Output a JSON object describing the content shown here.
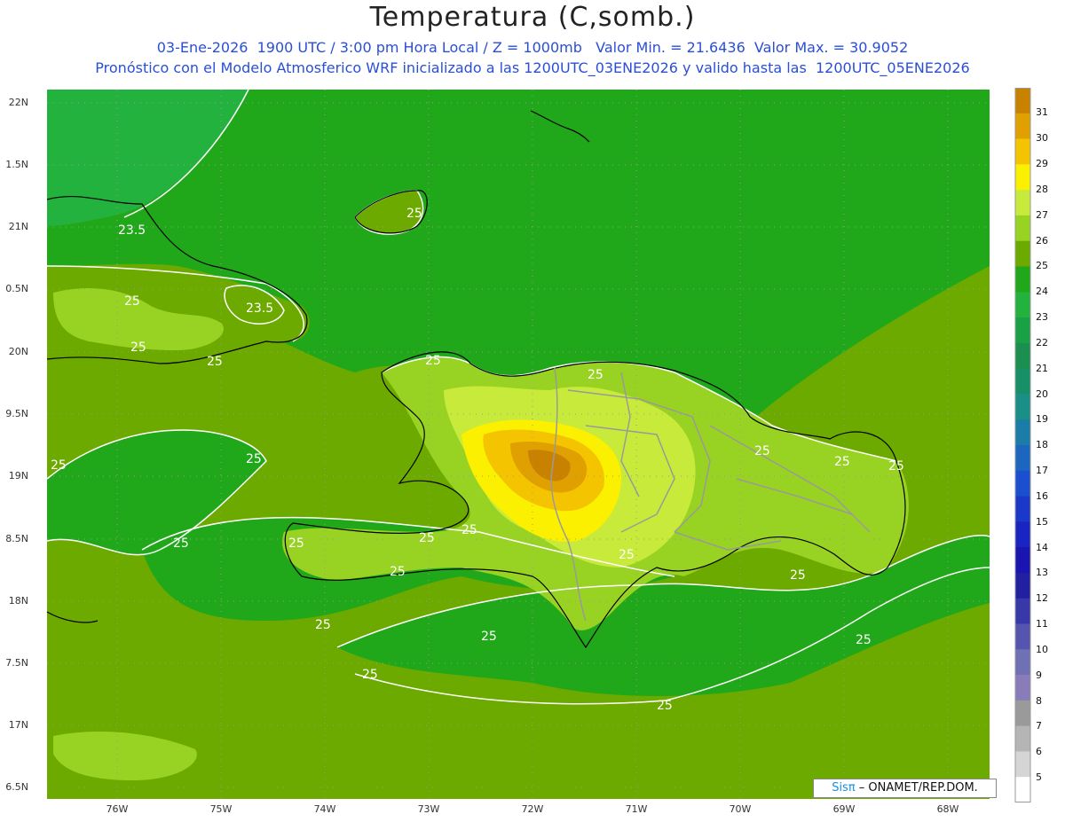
{
  "header": {
    "title": "Temperatura (C,somb.)",
    "line1": "03-Ene-2026  1900 UTC / 3:00 pm Hora Local / Z = 1000mb   Valor Min. = 21.6436  Valor Max. = 30.9052",
    "line2": "Pronóstico con el Modelo Atmosferico WRF inicializado a las 1200UTC_03ENE2026 y valido hasta las  1200UTC_05ENE2026"
  },
  "map": {
    "lat_labels": [
      "22N",
      "1.5N",
      "21N",
      "0.5N",
      "20N",
      "9.5N",
      "19N",
      "8.5N",
      "18N",
      "7.5N",
      "17N",
      "6.5N"
    ],
    "lon_labels": [
      "76W",
      "75W",
      "74W",
      "73W",
      "72W",
      "71W",
      "70W",
      "69W",
      "68W"
    ],
    "contour_labels": [
      "23.5",
      "23.5",
      "25",
      "25",
      "25",
      "25",
      "25",
      "25",
      "25",
      "25",
      "25",
      "25",
      "25",
      "25",
      "25",
      "25",
      "25",
      "25",
      "25",
      "25",
      "25",
      "25",
      "25",
      "25",
      "25"
    ]
  },
  "colorbar": {
    "labels": [
      "31",
      "30",
      "29",
      "28",
      "27",
      "26",
      "25",
      "24",
      "23",
      "22",
      "21",
      "20",
      "19",
      "18",
      "17",
      "16",
      "15",
      "14",
      "13",
      "12",
      "11",
      "10",
      "9",
      "8",
      "7",
      "6",
      "5"
    ],
    "colors": [
      "#c88200",
      "#e0a000",
      "#f5c400",
      "#faf000",
      "#c8ea3a",
      "#98d222",
      "#6caa00",
      "#21a81a",
      "#23b23d",
      "#1aa045",
      "#1b8f50",
      "#179068",
      "#1a8f88",
      "#1c7ca8",
      "#1c66c0",
      "#1a4fcf",
      "#1a39c8",
      "#1a24c0",
      "#1a14b0",
      "#2020a0",
      "#3838a8",
      "#5555b0",
      "#7070b5",
      "#8a7cb8",
      "#9a9a9a",
      "#b5b5b5",
      "#d5d5d5",
      "#ffffff"
    ]
  },
  "credit": {
    "brand": "Sisπ",
    "text": " – ONAMET/REP.DOM."
  }
}
